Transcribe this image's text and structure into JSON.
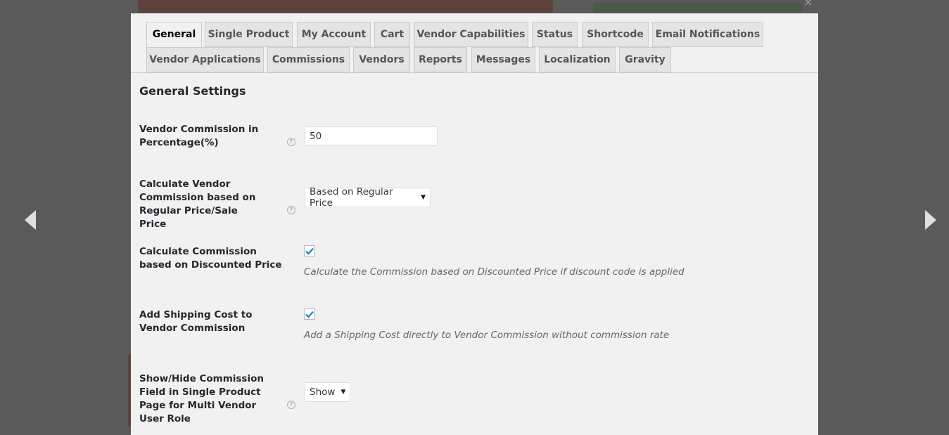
{
  "lightbox": {
    "close": "×"
  },
  "tabs": [
    "General",
    "Single Product",
    "My Account",
    "Cart",
    "Vendor Capabilities",
    "Status",
    "Shortcode",
    "Email Notifications",
    "Vendor Applications",
    "Commissions",
    "Vendors",
    "Reports",
    "Messages",
    "Localization",
    "Gravity"
  ],
  "settings": {
    "title": "General Settings",
    "vendor_commission": {
      "label": "Vendor Commission in Percentage(%)",
      "value": "50",
      "help": "?"
    },
    "commission_basis": {
      "label": "Calculate Vendor Commission based on Regular Price/Sale Price",
      "selected": "Based on Regular Price",
      "help": "?"
    },
    "discounted": {
      "label": "Calculate Commission based on Discounted Price",
      "checked": true,
      "description": "Calculate the Commission based on Discounted Price if discount code is applied"
    },
    "shipping": {
      "label": "Add Shipping Cost to Vendor Commission",
      "checked": true,
      "description": "Add a Shipping Cost directly to Vendor Commission without commission rate"
    },
    "show_hide": {
      "label": "Show/Hide Commission Field in Single Product Page for Multi Vendor User Role",
      "selected": "Show",
      "help": "?"
    }
  },
  "colors": {
    "checkmark": "#1e8cbe",
    "accent_dark": "#23282d"
  }
}
